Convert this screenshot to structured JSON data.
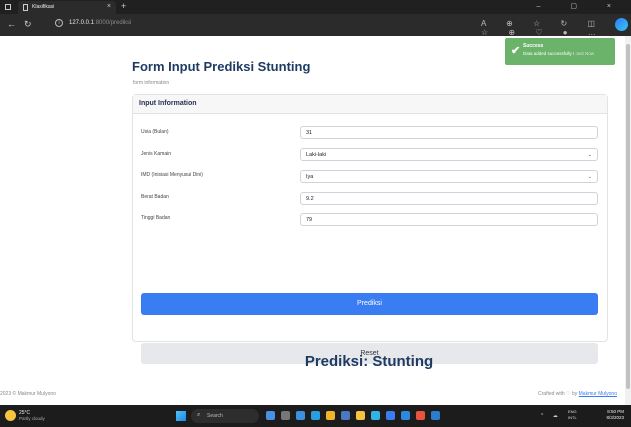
{
  "browser": {
    "tab_title": "Klasifikasi",
    "tab_close": "×",
    "new_tab": "+",
    "url_host": "127.0.0.1",
    "url_path": ":8000/prediksi",
    "window_controls": "– ▢ ×"
  },
  "page": {
    "title": "Form Input Prediksi Stunting",
    "subtitle": "form information",
    "card_header": "Input Information",
    "fields": [
      {
        "label": "Usia (Bulan)",
        "value": "31",
        "type": "input"
      },
      {
        "label": "Jenis Kamain",
        "value": "Laki-laki",
        "type": "select"
      },
      {
        "label": "IMD (Inisiasi Menyusui Dini)",
        "value": "Iya",
        "type": "select"
      },
      {
        "label": "Berat Badan",
        "value": "9.2",
        "type": "input"
      },
      {
        "label": "Tinggi Badan",
        "value": "79",
        "type": "input"
      }
    ],
    "predict_button": "Prediksi",
    "reset_button": "Reset",
    "result": "Prediksi: Stunting"
  },
  "footer": {
    "copyright": "2023 © Makmur Mulyono",
    "crafted_prefix": "Crafted with",
    "crafted_by": "by",
    "crafted_link": "Makmur Mulyono"
  },
  "toast": {
    "title": "Success",
    "message": "Data added successfully !",
    "extra": "Just Now"
  },
  "taskbar": {
    "temperature": "25°C",
    "weather": "Partly cloudy",
    "search_placeholder": "Search",
    "lang_1": "ENG",
    "lang_2": "INTL",
    "time": "8:50 PM",
    "date": "8/3/2023"
  },
  "colors": {
    "primary": "#3a7cf2",
    "toast": "#6bb36b",
    "title": "#1f3b63"
  }
}
